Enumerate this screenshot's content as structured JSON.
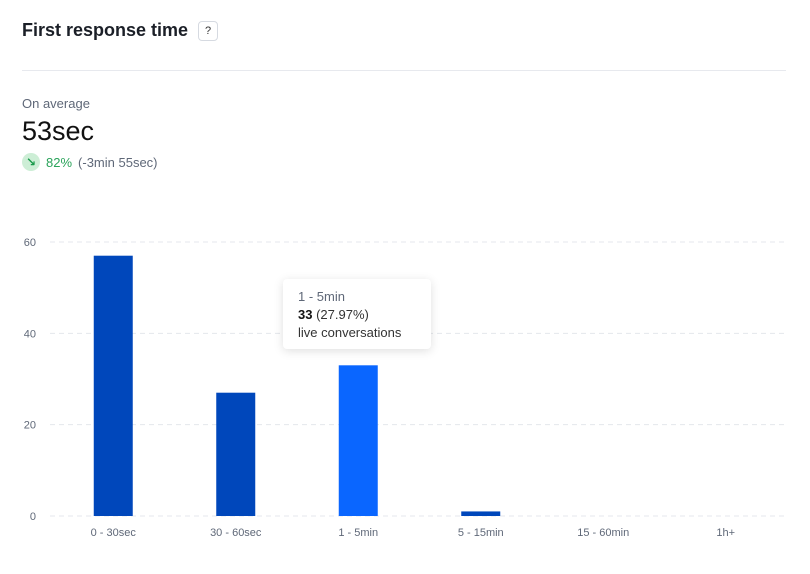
{
  "header": {
    "title": "First response time",
    "help_label": "?"
  },
  "summary": {
    "label": "On average",
    "value": "53sec",
    "trend_percent": "82%",
    "trend_diff": "(-3min 55sec)",
    "trend_icon": "arrow-down-right-icon",
    "trend_color": "#2aa35a"
  },
  "tooltip": {
    "category": "1 - 5min",
    "count": "33",
    "percent": "(27.97%)",
    "description": "live conversations"
  },
  "chart_data": {
    "type": "bar",
    "categories": [
      "0 - 30sec",
      "30 - 60sec",
      "1 - 5min",
      "5 - 15min",
      "15 - 60min",
      "1h+"
    ],
    "values": [
      57,
      27,
      33,
      1,
      0,
      0
    ],
    "highlighted_category": "1 - 5min",
    "yticks": [
      0,
      20,
      40,
      60
    ],
    "ylim": [
      0,
      60
    ],
    "grid": true,
    "colors": {
      "bar": "#0047bb",
      "highlight": "#0a66ff",
      "grid": "#e4e7ec",
      "tick": "#5f6878"
    }
  }
}
